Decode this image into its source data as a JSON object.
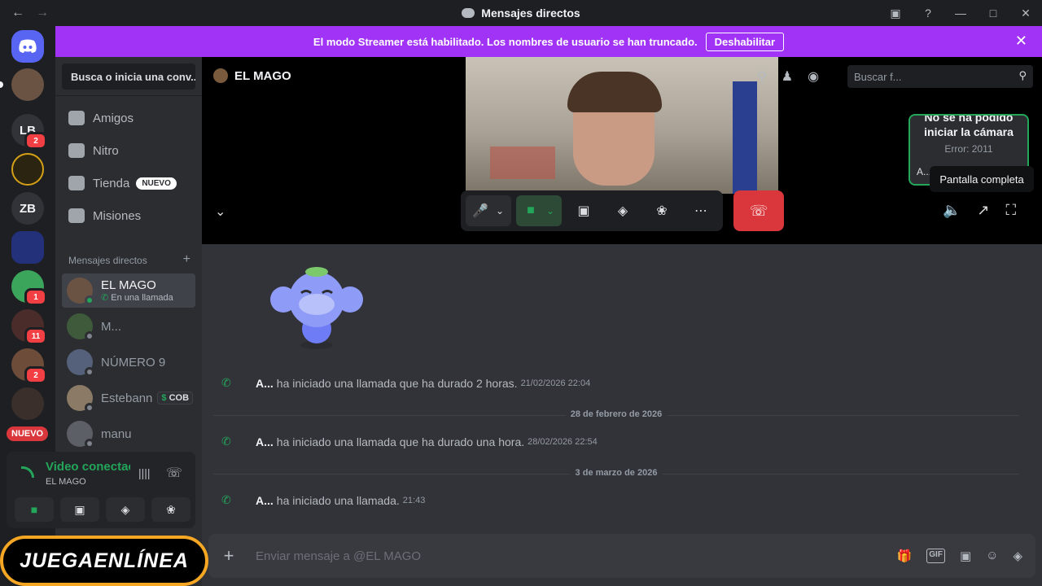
{
  "window": {
    "title": "Mensajes directos"
  },
  "banner": {
    "text": "El modo Streamer está habilitado. Los nombres de usuario se han truncado.",
    "button": "Deshabilitar"
  },
  "guilds": [
    {
      "label": "",
      "badge": ""
    },
    {
      "label": "LB",
      "badge": "2"
    },
    {
      "label": "",
      "badge": ""
    },
    {
      "label": "ZB",
      "badge": ""
    },
    {
      "label": "",
      "badge": ""
    },
    {
      "label": "",
      "badge": "1"
    },
    {
      "label": "",
      "badge": "11"
    },
    {
      "label": "",
      "badge": "2"
    },
    {
      "label": "",
      "badge": ""
    },
    {
      "label": "NUEVO",
      "badge": ""
    }
  ],
  "sidebar": {
    "search_placeholder": "Busca o inicia una conv...",
    "nav": [
      {
        "label": "Amigos"
      },
      {
        "label": "Nitro"
      },
      {
        "label": "Tienda",
        "badge": "NUEVO"
      },
      {
        "label": "Misiones"
      }
    ],
    "dm_header": "Mensajes directos",
    "dms": [
      {
        "name": "EL MAGO",
        "sub": "En una llamada"
      },
      {
        "name": "M..."
      },
      {
        "name": "NÚMERO 9"
      },
      {
        "name": "Estebann",
        "tag": "COB"
      },
      {
        "name": "manu"
      }
    ]
  },
  "voice": {
    "title": "Video conectac",
    "subtitle": "EL MAGO"
  },
  "call": {
    "title": "EL MAGO",
    "search_placeholder": "Buscar f...",
    "pip_line1": "No se ha podido",
    "pip_line2": "iniciar la cámara",
    "pip_error": "Error: 2011",
    "pip_name": "A...",
    "tooltip": "Pantalla completa"
  },
  "messages": [
    {
      "author": "A...",
      "text": "ha iniciado una llamada que ha durado 2 horas.",
      "time": "21/02/2026 22:04"
    },
    {
      "divider": "28 de febrero de 2026"
    },
    {
      "author": "A...",
      "text": "ha iniciado una llamada que ha durado una hora.",
      "time": "28/02/2026 22:54"
    },
    {
      "divider": "3 de marzo de 2026"
    },
    {
      "author": "A...",
      "text": "ha iniciado una llamada.",
      "time": "21:43"
    }
  ],
  "composer": {
    "placeholder": "Enviar mensaje a @EL MAGO"
  },
  "watermark": {
    "text": "JUEGAENLÍNEA"
  },
  "colors": {
    "brand": "#5865f2",
    "streamer": "#a033f5",
    "online": "#23a55a",
    "danger": "#da373c"
  }
}
